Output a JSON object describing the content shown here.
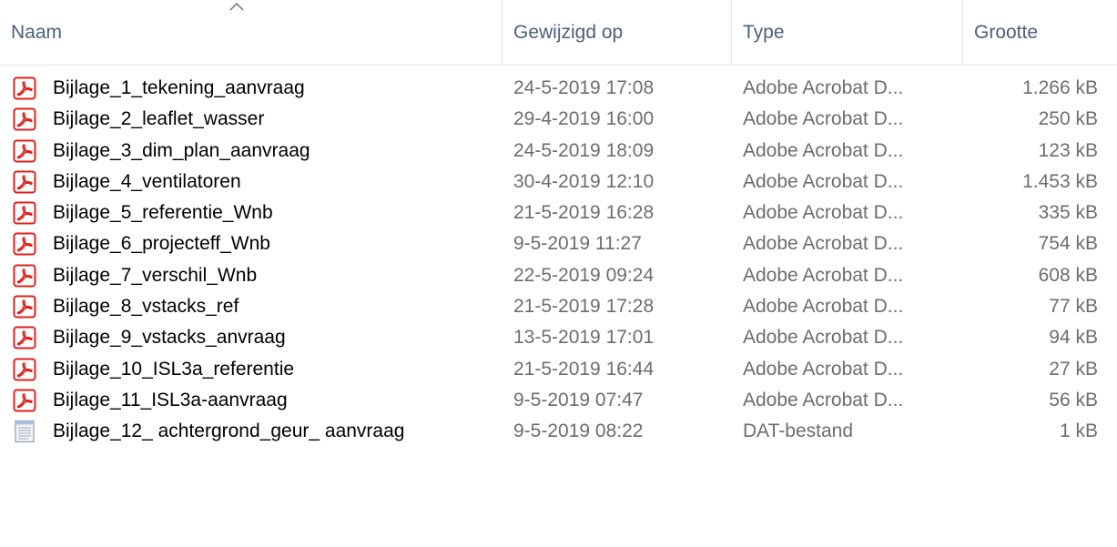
{
  "columns": {
    "name": "Naam",
    "date": "Gewijzigd op",
    "type": "Type",
    "size": "Grootte"
  },
  "sort": {
    "column": "name",
    "direction": "ascending",
    "indicator": "chevron-up"
  },
  "files": [
    {
      "name": "Bijlage_1_tekening_aanvraag",
      "date": "24-5-2019 17:08",
      "type": "Adobe Acrobat D...",
      "size": "1.266 kB",
      "icon": "pdf-file-icon"
    },
    {
      "name": "Bijlage_2_leaflet_wasser",
      "date": "29-4-2019 16:00",
      "type": "Adobe Acrobat D...",
      "size": "250 kB",
      "icon": "pdf-file-icon"
    },
    {
      "name": "Bijlage_3_dim_plan_aanvraag",
      "date": "24-5-2019 18:09",
      "type": "Adobe Acrobat D...",
      "size": "123 kB",
      "icon": "pdf-file-icon"
    },
    {
      "name": "Bijlage_4_ventilatoren",
      "date": "30-4-2019 12:10",
      "type": "Adobe Acrobat D...",
      "size": "1.453 kB",
      "icon": "pdf-file-icon"
    },
    {
      "name": "Bijlage_5_referentie_Wnb",
      "date": "21-5-2019 16:28",
      "type": "Adobe Acrobat D...",
      "size": "335 kB",
      "icon": "pdf-file-icon"
    },
    {
      "name": "Bijlage_6_projecteff_Wnb",
      "date": "9-5-2019 11:27",
      "type": "Adobe Acrobat D...",
      "size": "754 kB",
      "icon": "pdf-file-icon"
    },
    {
      "name": "Bijlage_7_verschil_Wnb",
      "date": "22-5-2019 09:24",
      "type": "Adobe Acrobat D...",
      "size": "608 kB",
      "icon": "pdf-file-icon"
    },
    {
      "name": "Bijlage_8_vstacks_ref",
      "date": "21-5-2019 17:28",
      "type": "Adobe Acrobat D...",
      "size": "77 kB",
      "icon": "pdf-file-icon"
    },
    {
      "name": "Bijlage_9_vstacks_anvraag",
      "date": "13-5-2019 17:01",
      "type": "Adobe Acrobat D...",
      "size": "94 kB",
      "icon": "pdf-file-icon"
    },
    {
      "name": "Bijlage_10_ISL3a_referentie",
      "date": "21-5-2019 16:44",
      "type": "Adobe Acrobat D...",
      "size": "27 kB",
      "icon": "pdf-file-icon"
    },
    {
      "name": "Bijlage_11_ISL3a-aanvraag",
      "date": "9-5-2019 07:47",
      "type": "Adobe Acrobat D...",
      "size": "56 kB",
      "icon": "pdf-file-icon"
    },
    {
      "name": "Bijlage_12_ achtergrond_geur_ aanvraag",
      "date": "9-5-2019 08:22",
      "type": "DAT-bestand",
      "size": "1 kB",
      "icon": "dat-file-icon"
    }
  ],
  "colors": {
    "header_text": "#4c607a",
    "secondary_text": "#6d6d6d",
    "pdf_icon_red": "#e0201c",
    "divider": "#e5e5e5"
  }
}
